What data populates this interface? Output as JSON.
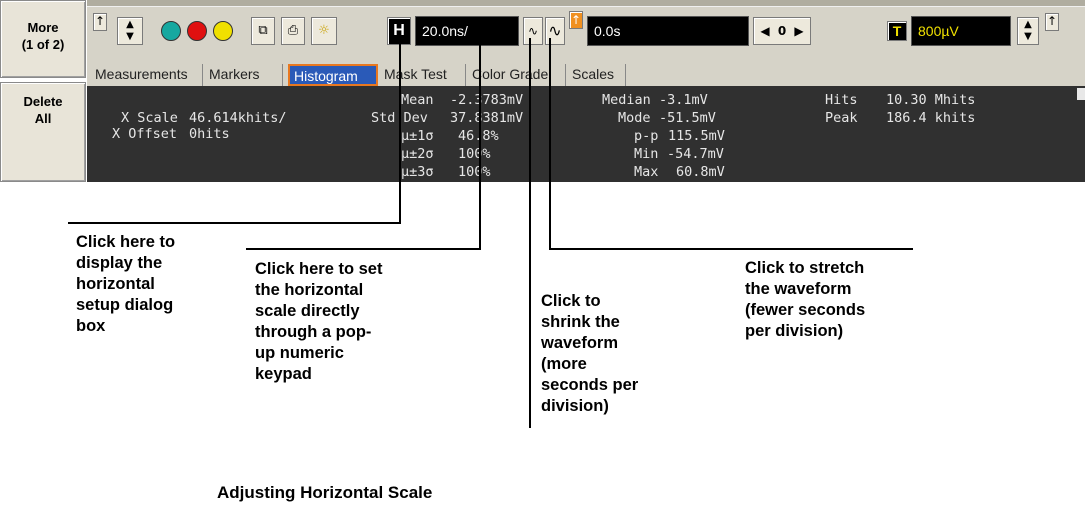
{
  "sidebar": {
    "more_label": "More\n(1 of 2)",
    "delete_label": "Delete\nAll"
  },
  "toolbar": {
    "h_button": "H",
    "scale_value": "20.0ns/",
    "shrink_glyph": "∿",
    "stretch_glyph": "∿",
    "delay_value": "0.0s",
    "nav_value": "0",
    "t_button": "T",
    "trigger_level": "800µV"
  },
  "tabs": [
    "Measurements",
    "Markers",
    "Histogram",
    "Mask Test",
    "Color Grade",
    "Scales"
  ],
  "active_tab": "Histogram",
  "panel": {
    "x_scale_label": "X Scale",
    "x_scale_value": "46.614khits/",
    "x_offset_label": "X Offset",
    "x_offset_value": "0hits",
    "stats_left": [
      {
        "label": "Mean",
        "value": "-2.3783mV"
      },
      {
        "label": "Std Dev",
        "value": "37.8381mV"
      },
      {
        "label": "µ±1σ",
        "value": "46.8%"
      },
      {
        "label": "µ±2σ",
        "value": "100%"
      },
      {
        "label": "µ±3σ",
        "value": "100%"
      }
    ],
    "stats_mid": [
      {
        "label": "Median",
        "value": "-3.1mV"
      },
      {
        "label": "Mode",
        "value": "-51.5mV"
      },
      {
        "label": "p-p",
        "value": "115.5mV"
      },
      {
        "label": "Min",
        "value": "-54.7mV"
      },
      {
        "label": "Max",
        "value": "60.8mV"
      }
    ],
    "stats_right": [
      {
        "label": "Hits",
        "value": "10.30 Mhits"
      },
      {
        "label": "Peak",
        "value": "186.4 khits"
      }
    ]
  },
  "callouts": {
    "setup_dialog": "Click here to\ndisplay the\nhorizontal\nsetup dialog\nbox",
    "keypad": "Click here to set\nthe horizontal\nscale directly\nthrough a pop-\nup numeric\nkeypad",
    "shrink": "Click to\nshrink the\nwaveform\n(more\nseconds per\ndivision)",
    "stretch": "Click to stretch\nthe waveform\n(fewer seconds\nper division)"
  },
  "caption": "Adjusting Horizontal Scale",
  "colors": {
    "panel_bg": "#303030",
    "active_tab_bg": "#2a5ab8",
    "active_tab_border": "#e87820",
    "trigger_text": "#f0e000",
    "toolbar_bg": "#d6d3c8"
  }
}
